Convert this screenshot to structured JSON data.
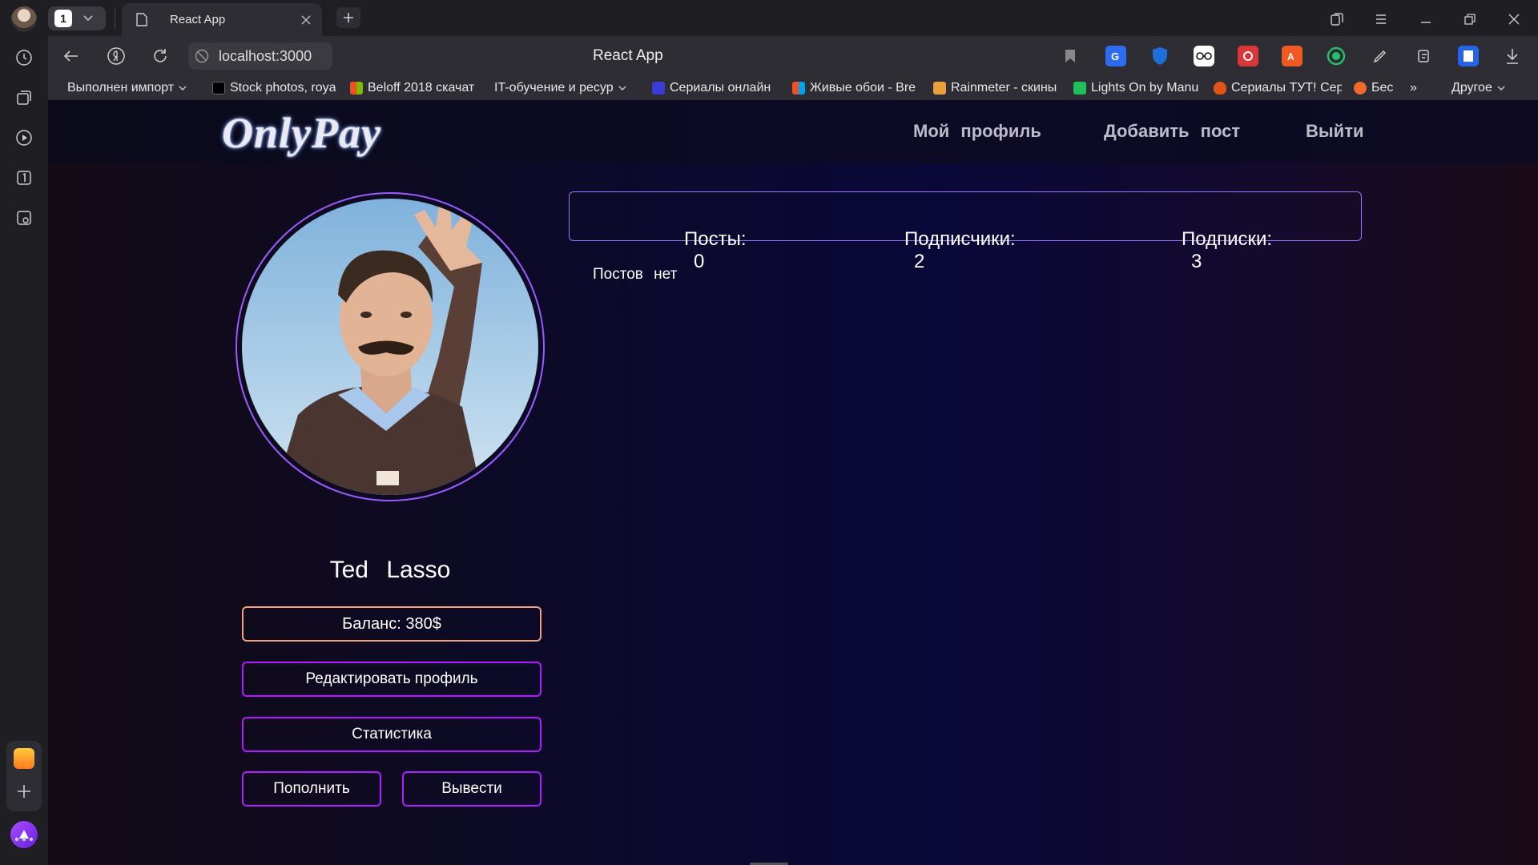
{
  "browser": {
    "tab_count": "1",
    "tab_title": "React App",
    "url": "localhost:3000",
    "page_title": "React App",
    "bookmarks": [
      {
        "label": "Выполнен импорт",
        "color": "#2d2d33"
      },
      {
        "label": "Stock photos, roya",
        "color": "#000000"
      },
      {
        "label": "Beloff 2018 скачат",
        "color": "#e24b26"
      },
      {
        "label": "IT-обучение и ресур",
        "color": "#2d2d33"
      },
      {
        "label": "Сериалы онлайн",
        "color": "#3b3bd6"
      },
      {
        "label": "Живые обои - Bre",
        "color": "#3aa0f0"
      },
      {
        "label": "Rainmeter - скины",
        "color": "#e8a03c"
      },
      {
        "label": "Lights On by Manu",
        "color": "#1fbf5a"
      },
      {
        "label": "Сериалы ТУТ! Сер",
        "color": "#e0541a"
      },
      {
        "label": "Бес",
        "color": "#f06a2a"
      }
    ],
    "bookmarks_more": "»",
    "bookmarks_other": "Другое"
  },
  "app": {
    "logo": "OnlyPay",
    "nav": {
      "profile": "Мой профиль",
      "add_post": "Добавить пост",
      "logout": "Выйти"
    },
    "user": {
      "name": "Ted Lasso",
      "balance": "Баланс: 380$"
    },
    "buttons": {
      "edit_profile": "Редактировать профиль",
      "statistics": "Статистика",
      "deposit": "Пополнить",
      "withdraw": "Вывести"
    },
    "stats": {
      "posts_label": "Посты:",
      "posts_value": "0",
      "followers_label": "Подписчики:",
      "followers_value": "2",
      "following_label": "Подписки:",
      "following_value": "3"
    },
    "empty_posts": "Постов нет"
  },
  "colors": {
    "accent_border": "#b21bff",
    "balance_border": "#f5a07a",
    "stats_border": "#9a78ff"
  }
}
